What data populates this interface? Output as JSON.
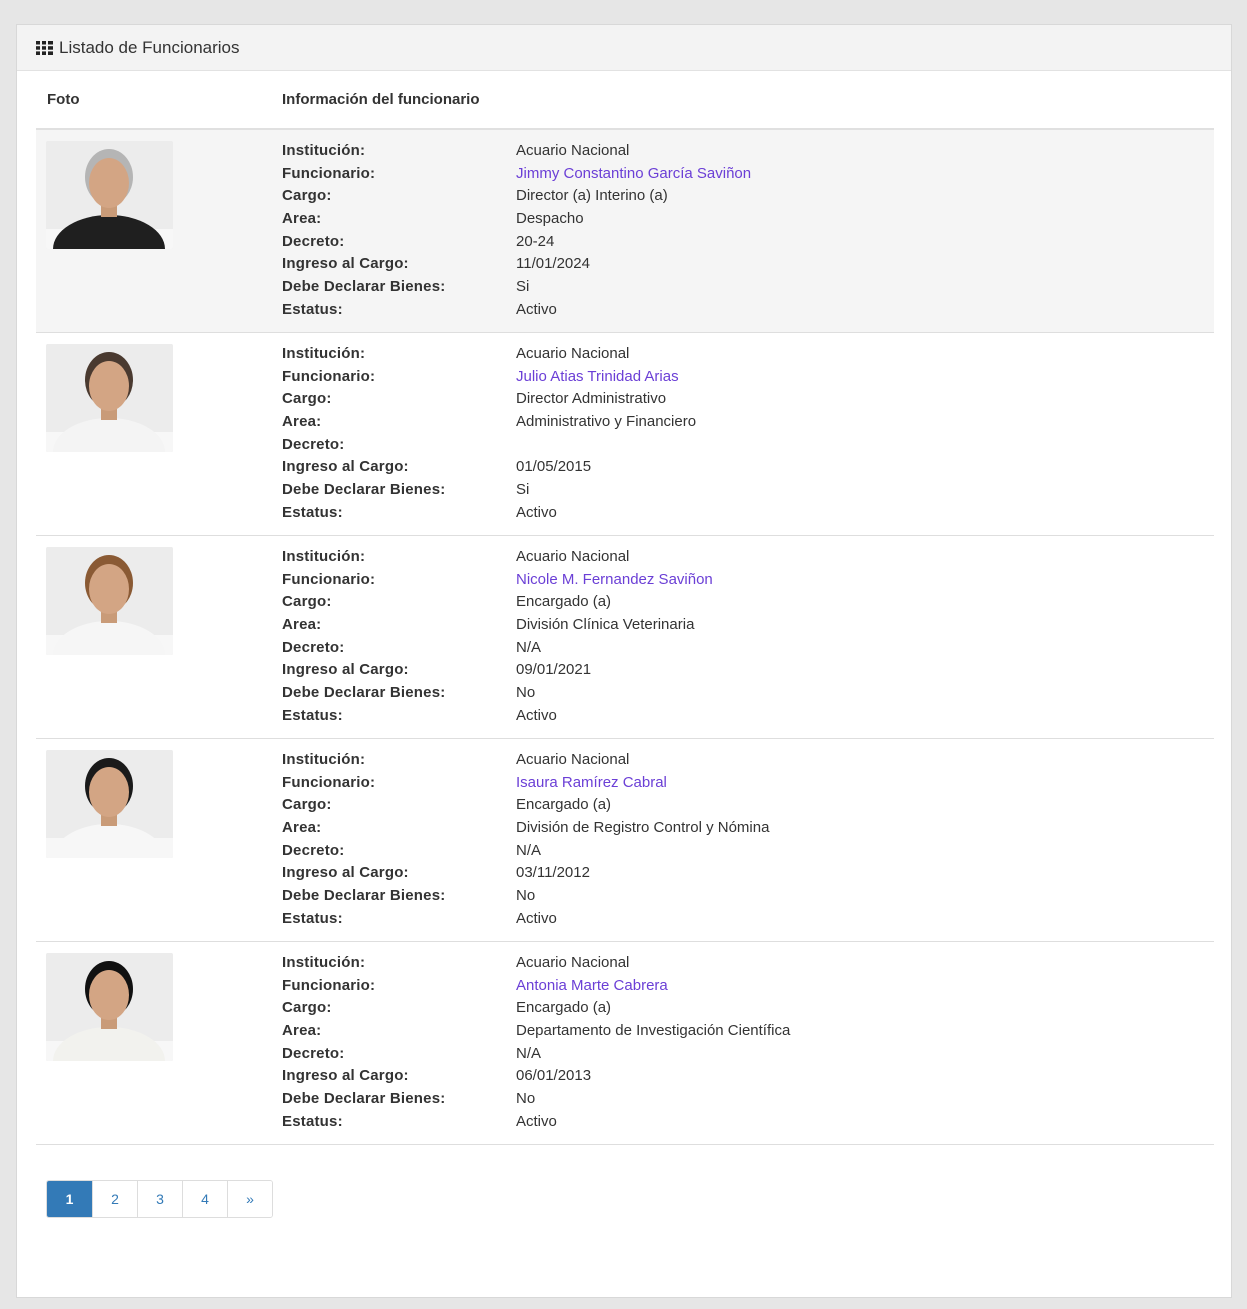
{
  "panel": {
    "title": "Listado de Funcionarios",
    "icon": "grid-icon"
  },
  "table": {
    "headers": {
      "foto": "Foto",
      "info": "Información del funcionario"
    },
    "field_labels": {
      "institucion": "Institución:",
      "funcionario": "Funcionario:",
      "cargo": "Cargo:",
      "area": "Area:",
      "decreto": "Decreto:",
      "ingreso": "Ingreso al Cargo:",
      "declarar": "Debe Declarar Bienes:",
      "estatus": "Estatus:"
    },
    "rows": [
      {
        "institucion": "Acuario Nacional",
        "funcionario": "Jimmy Constantino García Saviñon",
        "cargo": "Director (a) Interino (a)",
        "area": "Despacho",
        "decreto": "20-24",
        "ingreso": "11/01/2024",
        "declarar": "Si",
        "estatus": "Activo"
      },
      {
        "institucion": "Acuario Nacional",
        "funcionario": "Julio Atias Trinidad Arias",
        "cargo": "Director Administrativo",
        "area": "Administrativo y Financiero",
        "decreto": "",
        "ingreso": "01/05/2015",
        "declarar": "Si",
        "estatus": "Activo"
      },
      {
        "institucion": "Acuario Nacional",
        "funcionario": "Nicole M. Fernandez Saviñon",
        "cargo": "Encargado (a)",
        "area": "División Clínica Veterinaria",
        "decreto": "N/A",
        "ingreso": "09/01/2021",
        "declarar": "No",
        "estatus": "Activo"
      },
      {
        "institucion": "Acuario Nacional",
        "funcionario": "Isaura Ramírez Cabral",
        "cargo": "Encargado (a)",
        "area": "División de Registro Control y Nómina",
        "decreto": "N/A",
        "ingreso": "03/11/2012",
        "declarar": "No",
        "estatus": "Activo"
      },
      {
        "institucion": "Acuario Nacional",
        "funcionario": "Antonia Marte Cabrera",
        "cargo": "Encargado (a)",
        "area": "Departamento de Investigación Científica",
        "decreto": "N/A",
        "ingreso": "06/01/2013",
        "declarar": "No",
        "estatus": "Activo"
      }
    ]
  },
  "pagination": {
    "pages": [
      "1",
      "2",
      "3",
      "4",
      "»"
    ],
    "active": "1"
  },
  "colors": {
    "link": "#6b3fd6",
    "page_active": "#337ab7"
  }
}
